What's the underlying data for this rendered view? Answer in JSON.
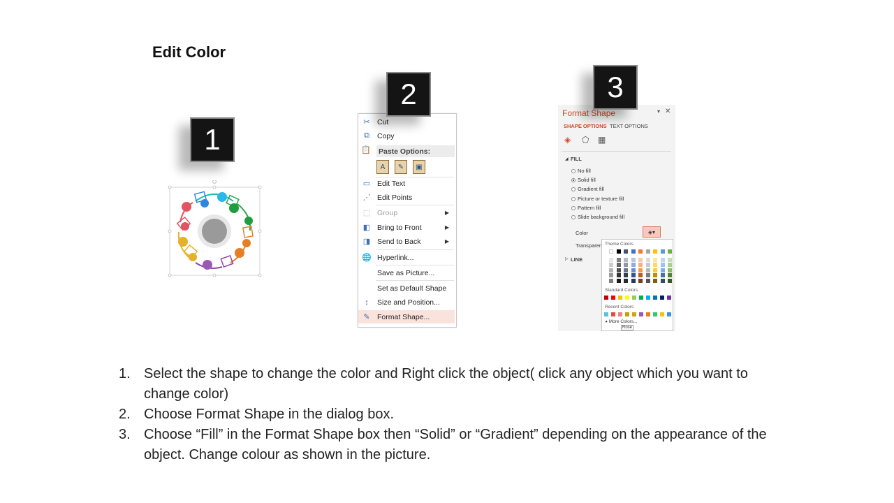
{
  "slide": {
    "title": "Edit Color",
    "badges": [
      "1",
      "2",
      "3"
    ]
  },
  "context_menu": {
    "items": [
      {
        "label": "Cut",
        "icon": "scissors-icon"
      },
      {
        "label": "Copy",
        "icon": "copy-icon"
      },
      {
        "label": "Paste Options:",
        "icon": "paste-icon"
      },
      {
        "label": "Edit Text",
        "icon": "edit-text-icon"
      },
      {
        "label": "Edit Points",
        "icon": "edit-points-icon"
      },
      {
        "label": "Group",
        "icon": "group-icon"
      },
      {
        "label": "Bring to Front",
        "icon": "bring-front-icon"
      },
      {
        "label": "Send to Back",
        "icon": "send-back-icon"
      },
      {
        "label": "Hyperlink...",
        "icon": "hyperlink-icon"
      },
      {
        "label": "Save as Picture...",
        "icon": ""
      },
      {
        "label": "Set as Default Shape",
        "icon": ""
      },
      {
        "label": "Size and Position...",
        "icon": "size-position-icon"
      },
      {
        "label": "Format Shape...",
        "icon": "format-shape-icon"
      }
    ]
  },
  "format_pane": {
    "title": "Format Shape",
    "tabs": [
      "SHAPE OPTIONS",
      "TEXT OPTIONS"
    ],
    "fill_section": "FILL",
    "fill_options": [
      "No fill",
      "Solid fill",
      "Gradient fill",
      "Picture or texture fill",
      "Pattern fill",
      "Slide background fill"
    ],
    "selected_fill": "Solid fill",
    "color_label": "Color",
    "transparency_label": "Transparency",
    "line_section": "LINE",
    "picker": {
      "theme_colors_label": "Theme Colors",
      "standard_colors_label": "Standard Colors",
      "recent_colors_label": "Recent Colors",
      "more_colors_label": "More Colors...",
      "tooltip": "Rose",
      "theme_top_row": [
        "#ffffff",
        "#000000",
        "#44546a",
        "#4472c4",
        "#ed7d31",
        "#a5a5a5",
        "#ffc000",
        "#5b9bd5",
        "#70ad47"
      ],
      "standard_row": [
        "#c00000",
        "#ff0000",
        "#ffc000",
        "#ffff00",
        "#92d050",
        "#00b050",
        "#00b0f0",
        "#0070c0",
        "#002060",
        "#7030a0"
      ],
      "recent_row": [
        "#5bc0de",
        "#e74c3c",
        "#f08080",
        "#c8a000",
        "#d4a017",
        "#9b59b6",
        "#e67e22",
        "#2ecc71",
        "#f1c40f",
        "#3498db"
      ]
    }
  },
  "instructions": [
    {
      "num": "1.",
      "text": "Select the shape to change the color and Right click the object( click any object which you want to change color)"
    },
    {
      "num": "2.",
      "text": "Choose Format Shape in the dialog box."
    },
    {
      "num": "3.",
      "text": "Choose “Fill” in the Format Shape box then “Solid” or “Gradient” depending on the appearance of the object. Change colour as shown in the picture."
    }
  ]
}
